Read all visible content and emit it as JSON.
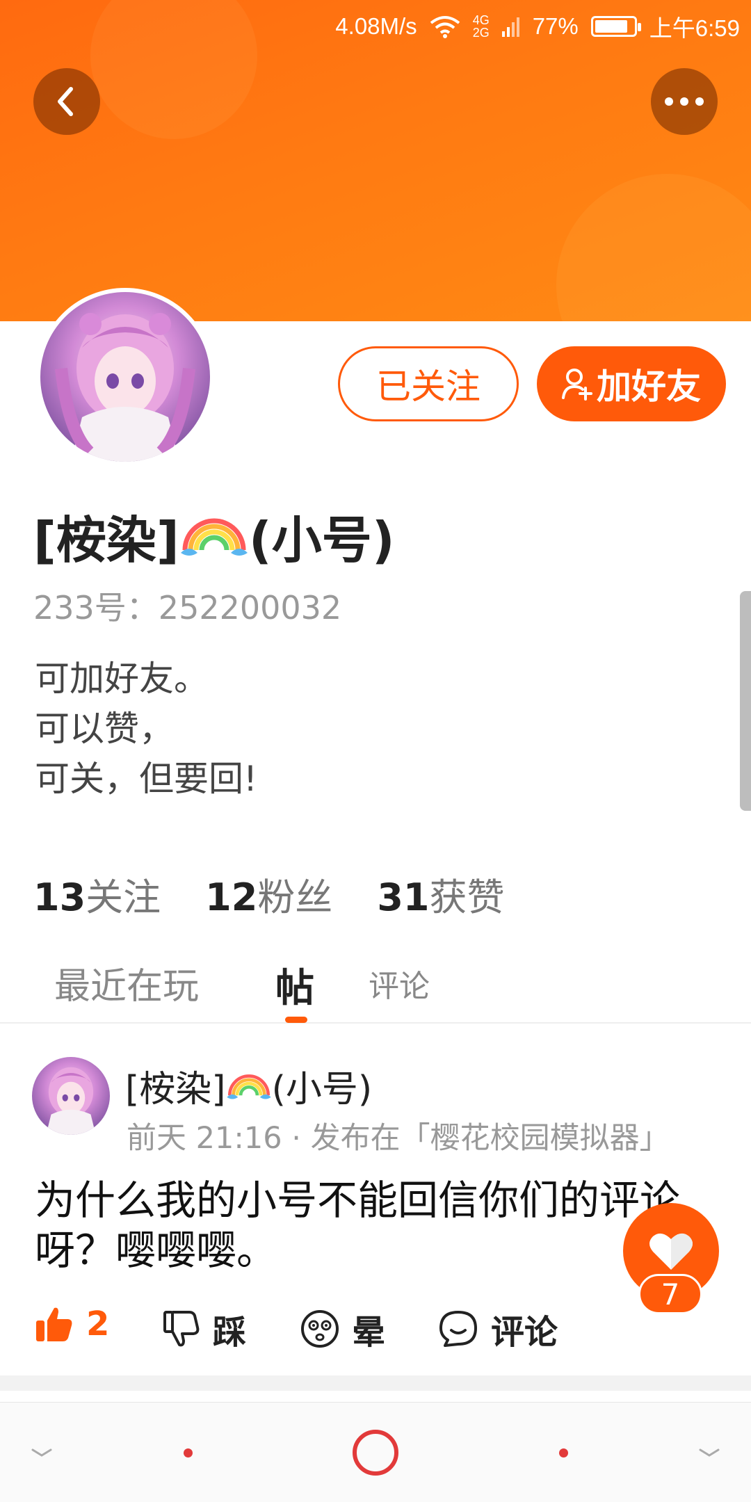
{
  "status_bar": {
    "speed": "4.08M/s",
    "network_top": "4G",
    "network_bottom": "2G",
    "battery": "77%",
    "battery_level": 0.77,
    "time": "上午6:59"
  },
  "colors": {
    "accent": "#ff5a0a",
    "banner": "#ff7a12"
  },
  "header": {
    "back_icon": "chevron-left-icon",
    "more_icon": "more-dots-icon"
  },
  "profile": {
    "nickname_prefix": "[桉染]",
    "nickname_suffix": "(小号)",
    "uid": "233号：252200032",
    "bio": [
      "可加好友。",
      "可以赞，",
      "可关，但要回!"
    ],
    "followed_label": "已关注",
    "add_friend_label": "加好友"
  },
  "stats": [
    {
      "num": "13",
      "label": "关注"
    },
    {
      "num": "12",
      "label": "粉丝"
    },
    {
      "num": "31",
      "label": "获赞"
    }
  ],
  "tabs": [
    "最近在玩",
    "帖",
    "评论"
  ],
  "post": {
    "author_prefix": "[桉染]",
    "author_suffix": "(小号)",
    "meta": "前天 21:16 · 发布在「樱花校园模拟器」",
    "text": "为什么我的小号不能回信你们的评论呀？嘤嘤嘤。",
    "float_like_count": "7",
    "actions": {
      "like_count": "2",
      "dislike_label": "踩",
      "dizzy_label": "晕",
      "comment_label": "评论"
    }
  }
}
